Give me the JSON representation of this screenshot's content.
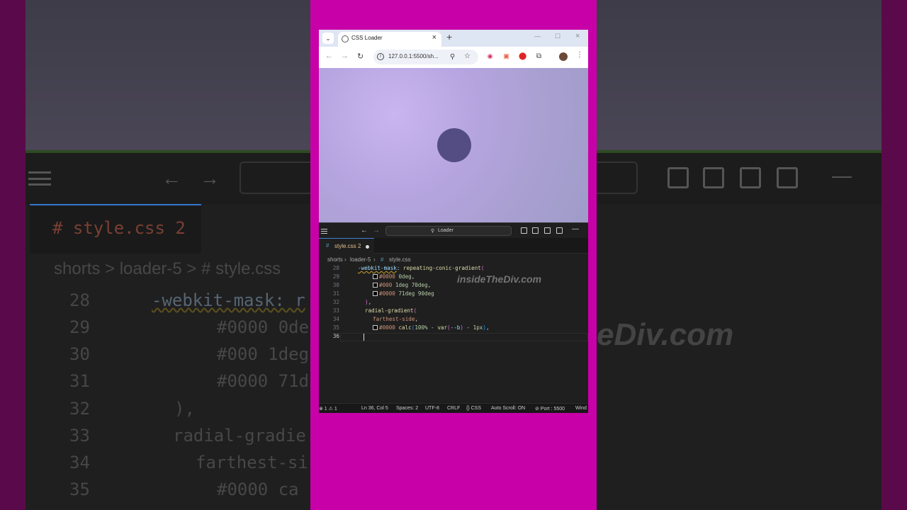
{
  "background": {
    "left_breadcrumb": "shorts > loader-5 > # style.css",
    "left_tab": "# style.css 2",
    "left_lines": [
      {
        "num": "28",
        "text": "-webkit-mask: r"
      },
      {
        "num": "29",
        "text": "#0000 0de"
      },
      {
        "num": "30",
        "text": "#000 1deg"
      },
      {
        "num": "31",
        "text": "#0000 71d"
      },
      {
        "num": "32",
        "text": "),"
      },
      {
        "num": "33",
        "text": "radial-gradie"
      },
      {
        "num": "34",
        "text": "farthest-si"
      },
      {
        "num": "35",
        "text": "#0000 ca"
      }
    ],
    "right_watermark": "eDiv.com"
  },
  "browser": {
    "tab_title": "CSS Loader",
    "url": "127.0.0.1:5500/sh...",
    "colors": {
      "tab_strip": "#dfe6f3",
      "viewport_accent": "#534d84"
    }
  },
  "vscode": {
    "search_text": "Loader",
    "tab_name": "style.css",
    "tab_problems": "2",
    "breadcrumbs": [
      "shorts",
      "loader-5",
      "style.css"
    ],
    "watermark": "insideTheDiv.com",
    "lines": [
      {
        "num": "28"
      },
      {
        "num": "29"
      },
      {
        "num": "30"
      },
      {
        "num": "31"
      },
      {
        "num": "32"
      },
      {
        "num": "33"
      },
      {
        "num": "34"
      },
      {
        "num": "35"
      },
      {
        "num": "36"
      }
    ],
    "code": {
      "l28_prop": "-webkit-mask",
      "l28_fn": "repeating-conic-gradient",
      "l29_color": "#0000",
      "l29_val": "0deg",
      "l30_color": "#000",
      "l30_val": "1deg 70deg",
      "l31_color": "#0000",
      "l31_val": "71deg 90deg",
      "l33_fn": "radial-gradient",
      "l34_val": "farthest-side",
      "l35_color": "#0000",
      "l35_fn": "calc",
      "l35_num": "100%",
      "l35_var": "var",
      "l35_arg": "--b",
      "l35_px": "1px"
    },
    "status": {
      "problems": "⊗ 1 ⚠ 1",
      "position": "Ln 36, Col 5",
      "spaces": "Spaces: 2",
      "encoding": "UTF-8",
      "eol": "CRLF",
      "language": "{} CSS",
      "autoscroll": "Auto Scroll: ON",
      "port": "⊘ Port : 5500",
      "extra": "Wind"
    }
  }
}
